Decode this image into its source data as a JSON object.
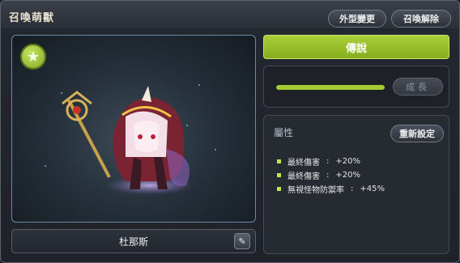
{
  "window": {
    "title": "召喚萌獸",
    "buttons": {
      "appearance": "外型變更",
      "release": "召喚解除"
    }
  },
  "pet": {
    "name": "杜那斯",
    "grade": "傳說",
    "growth_progress": 1.0,
    "grow_label": "成長"
  },
  "attributes": {
    "label": "屬性",
    "reset_label": "重新設定",
    "items": [
      {
        "name": "最終傷害",
        "sep": ":",
        "value": "+20%"
      },
      {
        "name": "最終傷害",
        "sep": ":",
        "value": "+20%"
      },
      {
        "name": "無視怪物防禦率",
        "sep": ":",
        "value": "+45%"
      }
    ]
  },
  "colors": {
    "accent": "#98c12b",
    "bullet": "#c4e54a"
  },
  "icons": {
    "badge": "star-icon",
    "edit": "pencil-icon"
  }
}
